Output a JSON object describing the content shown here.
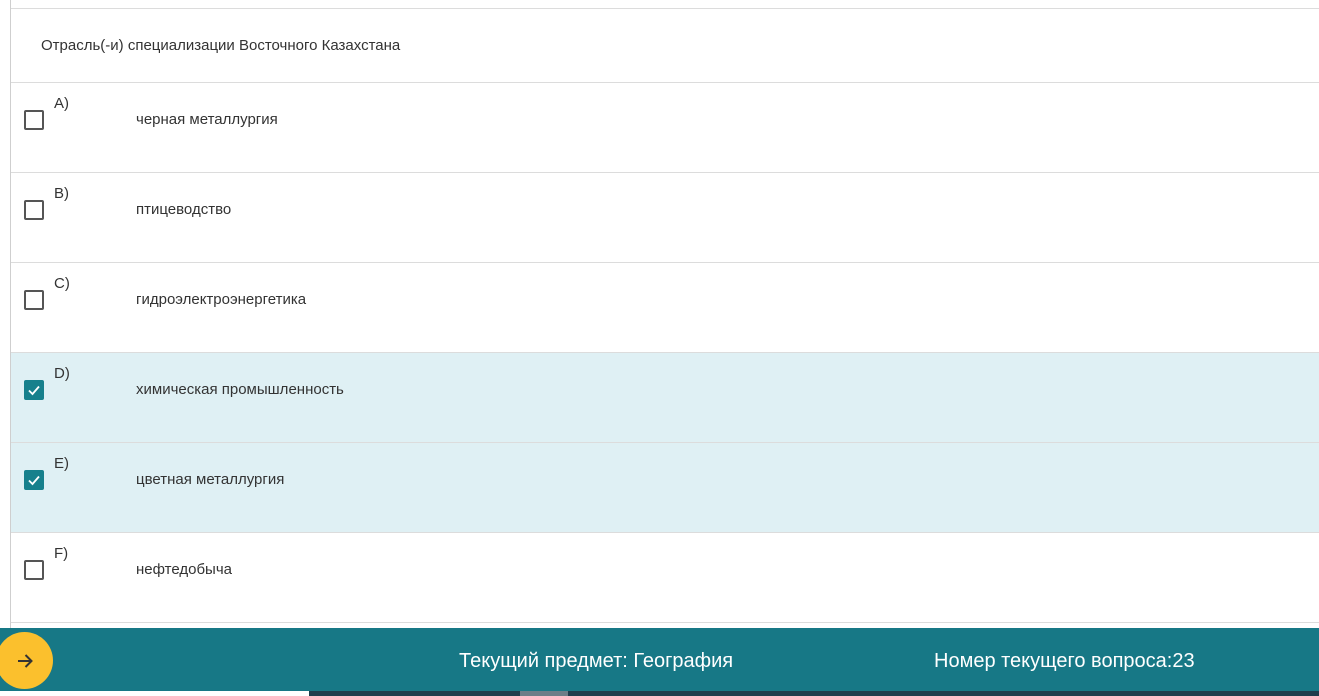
{
  "question": {
    "text": "Отрасль(-и) специализации Восточного Казахстана"
  },
  "options": [
    {
      "letter": "A)",
      "text": "черная металлургия",
      "checked": false
    },
    {
      "letter": "B)",
      "text": "птицеводство",
      "checked": false
    },
    {
      "letter": "C)",
      "text": "гидроэлектроэнергетика",
      "checked": false
    },
    {
      "letter": "D)",
      "text": "химическая промышленность",
      "checked": true
    },
    {
      "letter": "E)",
      "text": "цветная металлургия",
      "checked": true
    },
    {
      "letter": "F)",
      "text": "нефтедобыча",
      "checked": false
    }
  ],
  "footer": {
    "subject": "Текущий предмет: География",
    "question_number": "Номер текущего вопроса:23",
    "next_icon": "arrow-right-icon"
  },
  "colors": {
    "accent": "#177886",
    "selected_row": "#dff0f4",
    "checkbox_checked": "#17808c",
    "next_button": "#fbc02d"
  }
}
